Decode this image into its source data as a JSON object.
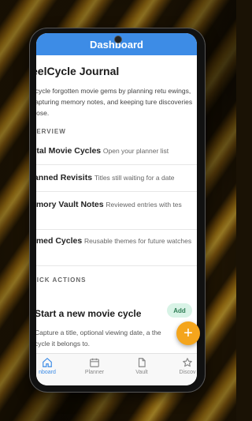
{
  "appbar": {
    "title": "Dashboard"
  },
  "header": {
    "title": "eelCycle Journal",
    "intro": "ecycle forgotten movie gems by planning retu ewings, capturing memory notes, and keeping ture discoveries close."
  },
  "overview": {
    "heading": "VERVIEW",
    "items": [
      {
        "label": "otal Movie Cycles",
        "desc": "Open your planner list"
      },
      {
        "label": "lanned Revisits",
        "desc": "Titles still waiting for a date"
      },
      {
        "label": "emory Vault Notes",
        "desc": "Reviewed entries with tes"
      },
      {
        "label": "amed Cycles",
        "desc": "Reusable themes for future watches"
      }
    ]
  },
  "quick_actions": {
    "heading": "UICK ACTIONS",
    "card_title": "Start a new movie cycle",
    "card_body": "Capture a title, optional viewing date, a the cycle it belongs to.",
    "add_label": "Add"
  },
  "fab": {
    "symbol": "+"
  },
  "nav": {
    "items": [
      {
        "label": "nboard",
        "icon": "home-icon"
      },
      {
        "label": "Planner",
        "icon": "calendar-icon"
      },
      {
        "label": "Vault",
        "icon": "document-icon"
      },
      {
        "label": "Discov",
        "icon": "star-icon"
      }
    ]
  },
  "colors": {
    "accent": "#3d8ce6",
    "fab": "#f4a51c",
    "pill_bg": "#d8f3e6",
    "pill_text": "#2f7d55"
  }
}
